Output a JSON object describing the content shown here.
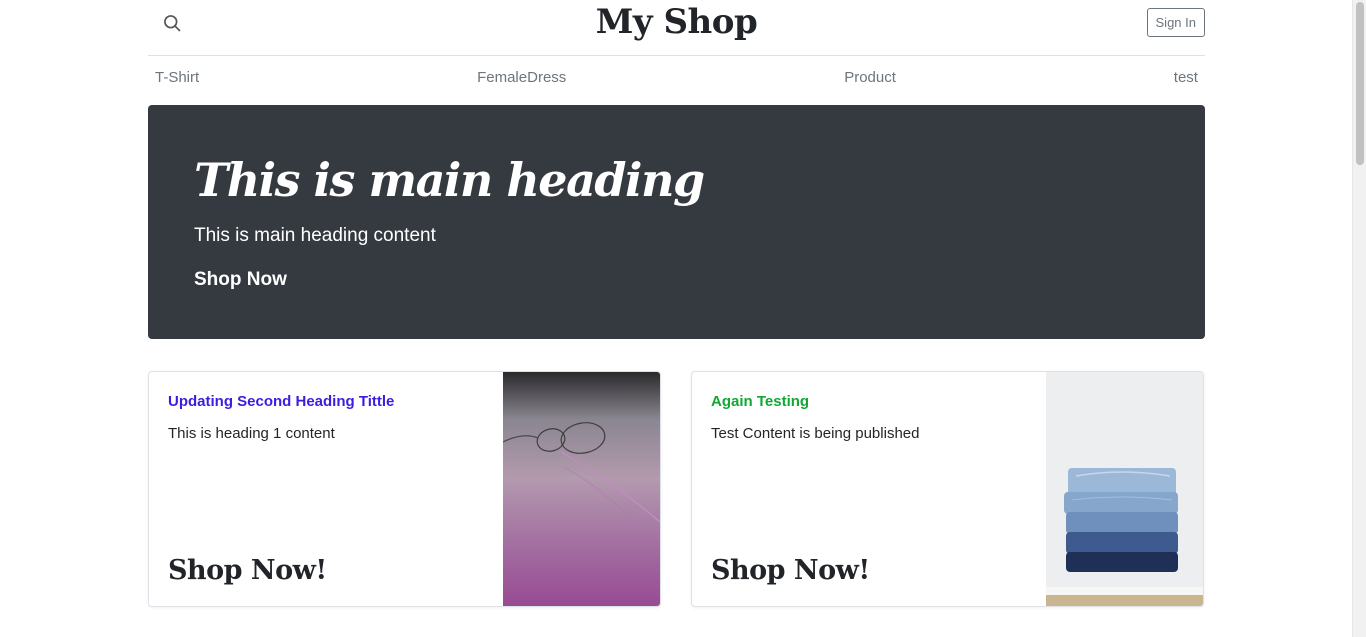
{
  "header": {
    "brand": "My Shop",
    "signin_label": "Sign In"
  },
  "nav": {
    "items": [
      {
        "label": "T-Shirt"
      },
      {
        "label": "FemaleDress"
      },
      {
        "label": "Product"
      },
      {
        "label": "test"
      }
    ]
  },
  "hero": {
    "heading": "This is main heading",
    "content": "This is main heading content",
    "link": "Shop Now"
  },
  "cards": [
    {
      "title": "Updating Second Heading Tittle",
      "title_color": "#3a1ee0",
      "content": "This is heading 1 content",
      "cta": "Shop Now!",
      "image": "eyeglasses-photo"
    },
    {
      "title": "Again Testing",
      "title_color": "#12a832",
      "content": "Test Content is being published",
      "cta": "Shop Now!",
      "image": "folded-jeans-photo"
    }
  ],
  "colors": {
    "hero_bg": "#343a40",
    "muted": "#6c757d"
  }
}
